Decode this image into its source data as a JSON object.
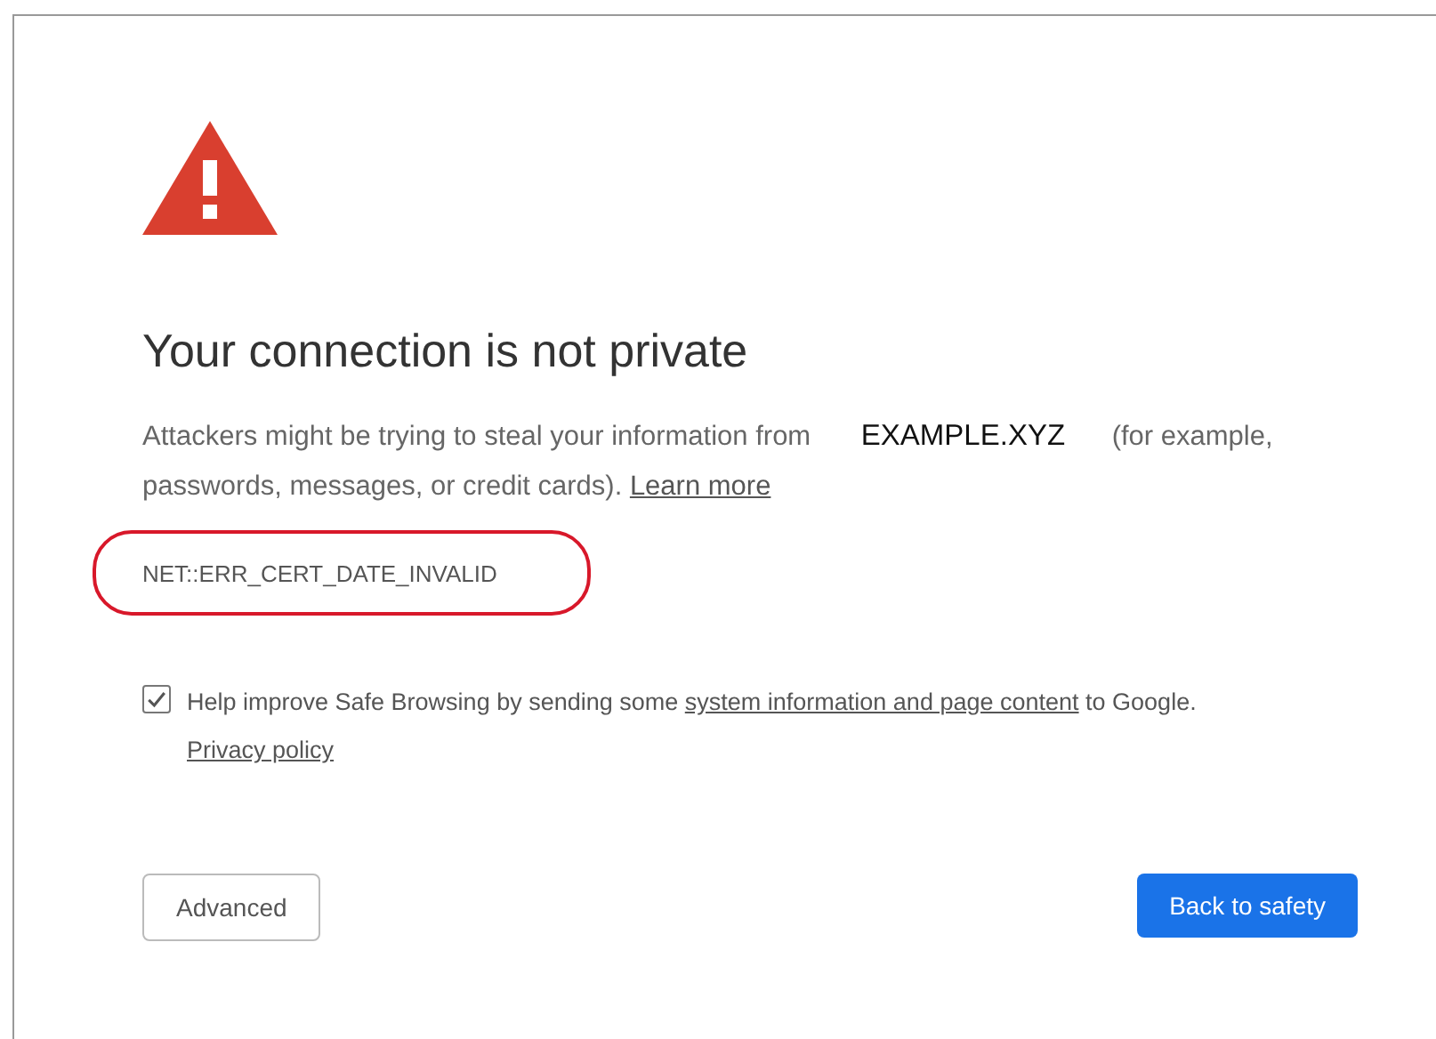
{
  "heading": "Your connection is not private",
  "message": {
    "before": "Attackers might be trying to steal your information from",
    "domain": "EXAMPLE.XYZ",
    "after": "(for example, passwords, messages, or credit cards).",
    "link": "Learn more"
  },
  "error_code": "NET::ERR_CERT_DATE_INVALID",
  "opt_in": {
    "checked": true,
    "before": "Help improve Safe Browsing by sending some",
    "link": "system information and page content",
    "after": "to Google.",
    "policy_link": "Privacy policy"
  },
  "buttons": [
    {
      "label": "Advanced",
      "kind": "secondary"
    },
    {
      "label": "Back to safety",
      "kind": "primary"
    }
  ]
}
